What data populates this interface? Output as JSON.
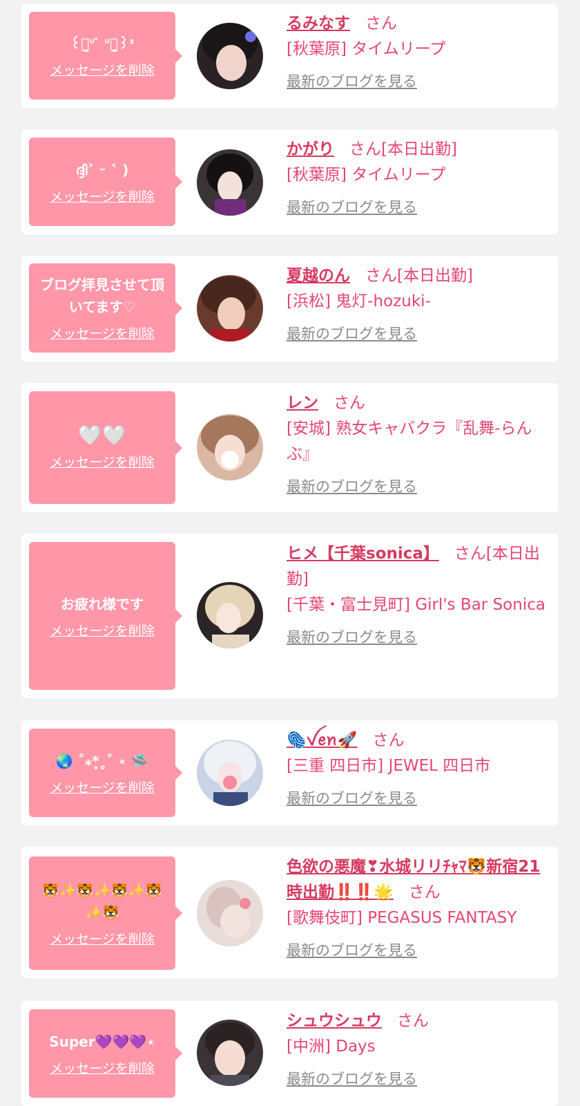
{
  "delete_label": "メッセージを削除",
  "blog_label": "最新のブログを見る",
  "honorific": "さん",
  "colors": {
    "bubble": "#ff97a8",
    "name": "#d63a61",
    "text": "#e64571",
    "blog": "#8a8a8a"
  },
  "items": [
    {
      "message": "꒰ꐦ̣̫ᐡ ̇ ᐡꐦ̣̫꒱ᵌ",
      "name": "るみなす",
      "status": "",
      "shop": "[秋葉原] タイムリープ"
    },
    {
      "message": "ദ്ദി˃ ᵕ ˂ )",
      "name": "かがり",
      "status": "[本日出勤]",
      "shop": "[秋葉原] タイムリープ"
    },
    {
      "message": "ブログ拝見させて頂いてます♡",
      "name": "夏越のん",
      "status": "[本日出勤]",
      "shop": "[浜松] 鬼灯-hozuki-"
    },
    {
      "message": "🤍🤍",
      "name": "レン",
      "status": "",
      "shop": "[安城] 熟女キャバクラ『乱舞-らんぶ』"
    },
    {
      "message": "お疲れ様です",
      "name": "ヒメ【千葉sonica】",
      "status": "[本日出勤]",
      "shop": "[千葉・富士見町] Girl's Bar Sonica"
    },
    {
      "message": "🌏 ˚⁎*̥˳˚ ⋆ 🛸",
      "name": "🫆ꪜꫀꪀ🚀",
      "status": "",
      "shop": "[三重 四日市] JEWEL 四日市"
    },
    {
      "message": "🐯✨🐯✨🐯✨🐯✨🐯",
      "name": "色欲の悪魔❣水城リリﾁｬﾏ🐯新宿21時出勤‼️‼️🌟",
      "status": "",
      "shop": "[歌舞伎町] PEGASUS FANTASY"
    },
    {
      "message": "Super💜💜💜⋆",
      "name": "シュウシュウ",
      "status": "",
      "shop": "[中洲] Days"
    }
  ]
}
